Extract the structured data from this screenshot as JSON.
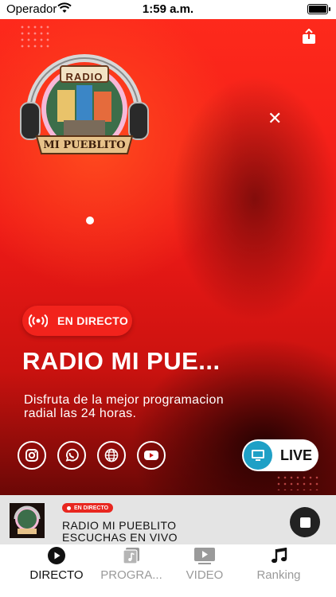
{
  "status_bar": {
    "carrier": "Operador",
    "time": "1:59 a.m."
  },
  "hero": {
    "live_badge": "EN DIRECTO",
    "station_title": "RADIO MI PUE...",
    "description": "Disfruta de la mejor programacion radial las 24 horas.",
    "live_button": "LIVE",
    "logo": {
      "text_top": "RADIO",
      "text_bottom": "MI PUEBLITO"
    },
    "social_icons": [
      "instagram-icon",
      "whatsapp-icon",
      "globe-icon",
      "youtube-icon"
    ]
  },
  "mini_player": {
    "badge": "EN DIRECTO",
    "line1": "RADIO MI PUEBLITO",
    "line2": "ESCUCHAS EN VIVO"
  },
  "tabs": [
    {
      "label": "DIRECTO",
      "icon": "play-circle-icon",
      "active": true
    },
    {
      "label": "PROGRA...",
      "icon": "playlist-icon",
      "active": false
    },
    {
      "label": "VIDEO",
      "icon": "video-icon",
      "active": false
    },
    {
      "label": "Ranking",
      "icon": "music-note-icon",
      "active": false
    }
  ],
  "colors": {
    "accent": "#f2231c",
    "live_tv": "#1fa0c6",
    "background_red": "#ef1a17"
  }
}
